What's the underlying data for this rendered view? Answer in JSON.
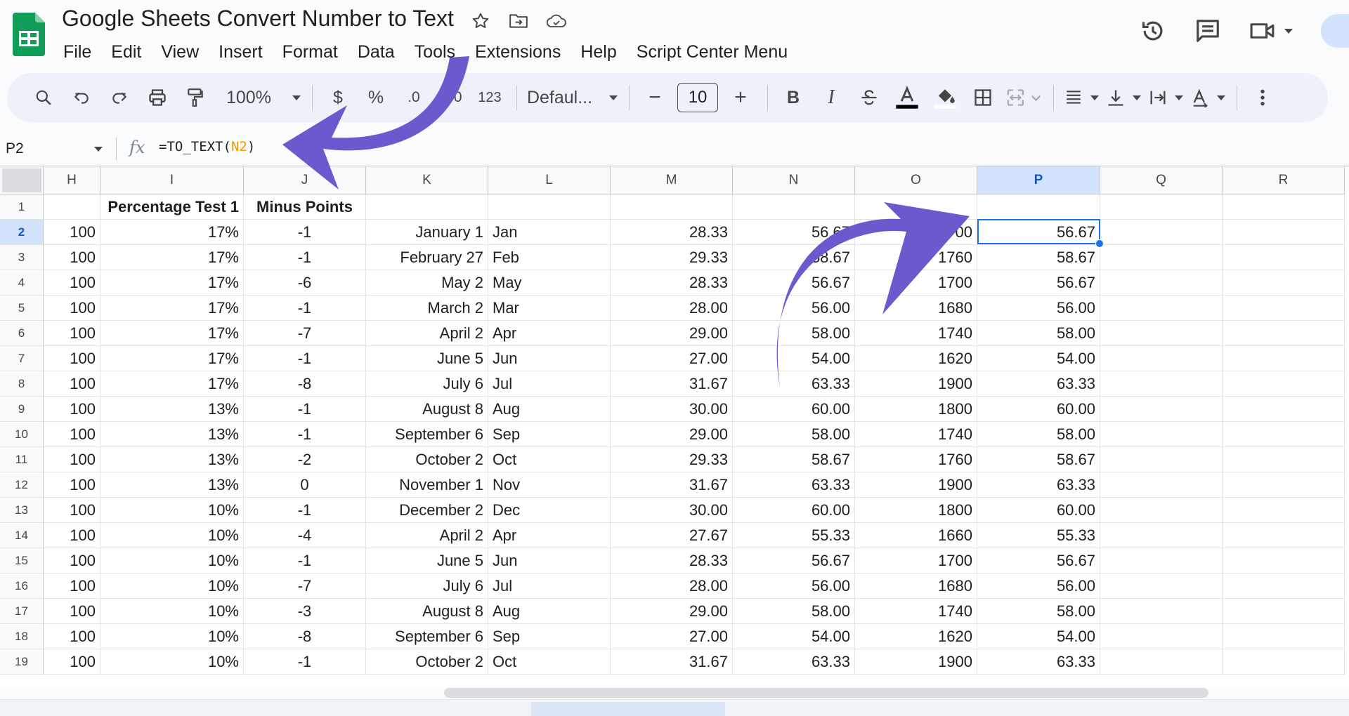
{
  "document": {
    "title": "Google Sheets Convert Number to Text"
  },
  "title_icons": [
    "star-icon",
    "move-to-folder-icon",
    "cloud-saved-icon"
  ],
  "menu": [
    "File",
    "Edit",
    "View",
    "Insert",
    "Format",
    "Data",
    "Tools",
    "Extensions",
    "Help",
    "Script Center Menu"
  ],
  "header_actions": [
    "history-icon",
    "comments-icon",
    "meet-icon"
  ],
  "toolbar": {
    "zoom": "100%",
    "currency": "$",
    "percent": "%",
    "decrease_decimal": ".0",
    "increase_decimal": ".00",
    "more_formats": "123",
    "font": "Defaul...",
    "font_size": "10",
    "minus": "−",
    "plus": "+",
    "bold": "B",
    "italic": "I"
  },
  "formula_bar": {
    "cell_ref": "P2",
    "fx": "fx",
    "formula_prefix": "=TO_TEXT(",
    "formula_ref": "N2",
    "formula_suffix": ")"
  },
  "columns": [
    "H",
    "I",
    "J",
    "K",
    "L",
    "M",
    "N",
    "O",
    "P",
    "Q",
    "R"
  ],
  "active_column": "P",
  "selected_cell": "P2",
  "header_row": {
    "row": "1",
    "cells": [
      "",
      "Percentage Test 1",
      "Minus Points",
      "",
      "",
      "",
      "",
      "",
      "",
      "",
      ""
    ]
  },
  "rows": [
    {
      "row": "2",
      "cells": [
        "100",
        "17%",
        "-1",
        "January 1",
        "Jan",
        "28.33",
        "56.67",
        "1700",
        "56.67",
        "",
        ""
      ]
    },
    {
      "row": "3",
      "cells": [
        "100",
        "17%",
        "-1",
        "February 27",
        "Feb",
        "29.33",
        "58.67",
        "1760",
        "58.67",
        "",
        ""
      ]
    },
    {
      "row": "4",
      "cells": [
        "100",
        "17%",
        "-6",
        "May 2",
        "May",
        "28.33",
        "56.67",
        "1700",
        "56.67",
        "",
        ""
      ]
    },
    {
      "row": "5",
      "cells": [
        "100",
        "17%",
        "-1",
        "March 2",
        "Mar",
        "28.00",
        "56.00",
        "1680",
        "56.00",
        "",
        ""
      ]
    },
    {
      "row": "6",
      "cells": [
        "100",
        "17%",
        "-7",
        "April 2",
        "Apr",
        "29.00",
        "58.00",
        "1740",
        "58.00",
        "",
        ""
      ]
    },
    {
      "row": "7",
      "cells": [
        "100",
        "17%",
        "-1",
        "June 5",
        "Jun",
        "27.00",
        "54.00",
        "1620",
        "54.00",
        "",
        ""
      ]
    },
    {
      "row": "8",
      "cells": [
        "100",
        "17%",
        "-8",
        "July 6",
        "Jul",
        "31.67",
        "63.33",
        "1900",
        "63.33",
        "",
        ""
      ]
    },
    {
      "row": "9",
      "cells": [
        "100",
        "13%",
        "-1",
        "August 8",
        "Aug",
        "30.00",
        "60.00",
        "1800",
        "60.00",
        "",
        ""
      ]
    },
    {
      "row": "10",
      "cells": [
        "100",
        "13%",
        "-1",
        "September 6",
        "Sep",
        "29.00",
        "58.00",
        "1740",
        "58.00",
        "",
        ""
      ]
    },
    {
      "row": "11",
      "cells": [
        "100",
        "13%",
        "-2",
        "October 2",
        "Oct",
        "29.33",
        "58.67",
        "1760",
        "58.67",
        "",
        ""
      ]
    },
    {
      "row": "12",
      "cells": [
        "100",
        "13%",
        "0",
        "November 1",
        "Nov",
        "31.67",
        "63.33",
        "1900",
        "63.33",
        "",
        ""
      ]
    },
    {
      "row": "13",
      "cells": [
        "100",
        "10%",
        "-1",
        "December 2",
        "Dec",
        "30.00",
        "60.00",
        "1800",
        "60.00",
        "",
        ""
      ]
    },
    {
      "row": "14",
      "cells": [
        "100",
        "10%",
        "-4",
        "April 2",
        "Apr",
        "27.67",
        "55.33",
        "1660",
        "55.33",
        "",
        ""
      ]
    },
    {
      "row": "15",
      "cells": [
        "100",
        "10%",
        "-1",
        "June 5",
        "Jun",
        "28.33",
        "56.67",
        "1700",
        "56.67",
        "",
        ""
      ]
    },
    {
      "row": "16",
      "cells": [
        "100",
        "10%",
        "-7",
        "July 6",
        "Jul",
        "28.00",
        "56.00",
        "1680",
        "56.00",
        "",
        ""
      ]
    },
    {
      "row": "17",
      "cells": [
        "100",
        "10%",
        "-3",
        "August 8",
        "Aug",
        "29.00",
        "58.00",
        "1740",
        "58.00",
        "",
        ""
      ]
    },
    {
      "row": "18",
      "cells": [
        "100",
        "10%",
        "-8",
        "September 6",
        "Sep",
        "27.00",
        "54.00",
        "1620",
        "54.00",
        "",
        ""
      ]
    },
    {
      "row": "19",
      "cells": [
        "100",
        "10%",
        "-1",
        "October 2",
        "Oct",
        "31.67",
        "63.33",
        "1900",
        "63.33",
        "",
        ""
      ]
    }
  ],
  "colors": {
    "brand_green": "#0f9d58",
    "selection_blue": "#1a73e8",
    "arrow_purple": "#6a5acd",
    "formula_ref_orange": "#f29900"
  }
}
